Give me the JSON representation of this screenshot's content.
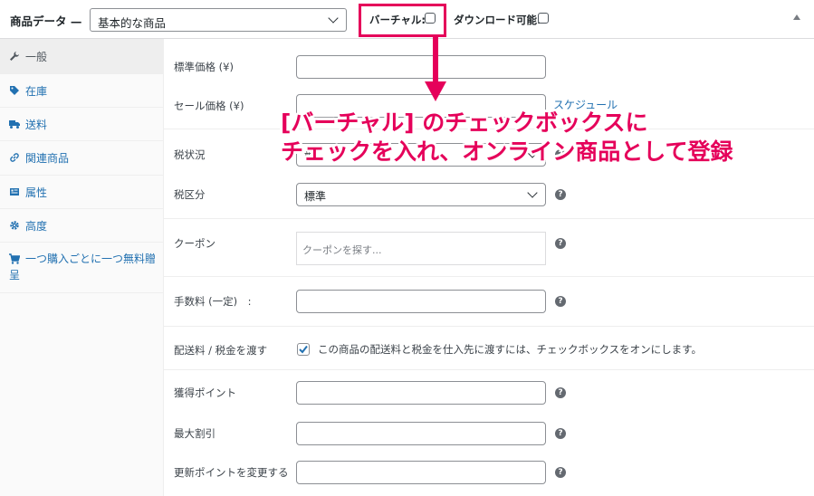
{
  "header": {
    "title": "商品データ —",
    "product_type_value": "基本的な商品",
    "virtual_label": "バーチャル:",
    "downloadable_label": "ダウンロード可能:"
  },
  "sidebar": {
    "items": [
      {
        "label": "一般",
        "icon": "wrench-icon"
      },
      {
        "label": "在庫",
        "icon": "tag-icon"
      },
      {
        "label": "送料",
        "icon": "truck-icon"
      },
      {
        "label": "関連商品",
        "icon": "link-icon"
      },
      {
        "label": "属性",
        "icon": "list-icon"
      },
      {
        "label": "高度",
        "icon": "gear-icon"
      },
      {
        "label": "一つ購入ごとに一つ無料贈",
        "label2": "呈",
        "icon": "cart-icon"
      }
    ]
  },
  "fields": {
    "regular_price_label": "標準価格 (¥)",
    "sale_price_label": "セール価格 (¥)",
    "schedule_link": "スケジュール",
    "tax_status_label": "税状況",
    "tax_status_value": "課",
    "tax_class_label": "税区分",
    "tax_class_value": "標準",
    "coupon_label": "クーポン",
    "coupon_placeholder": "クーポンを探す...",
    "fee_label": "手数料 (一定)　:",
    "shipping_tax_label": "配送料 / 税金を渡す",
    "shipping_tax_text": "この商品の配送料と税金を仕入先に渡すには、チェックボックスをオンにします。",
    "points_label": "獲得ポイント",
    "max_discount_label": "最大割引",
    "update_points_label": "更新ポイントを変更する"
  },
  "annotation": {
    "line1": "[バーチャル] のチェックボックスに",
    "line2": "チェックを入れ、オンライン商品として登録"
  },
  "colors": {
    "accent": "#e5005a",
    "link": "#2271b1",
    "checkbox": "#2271b1"
  }
}
